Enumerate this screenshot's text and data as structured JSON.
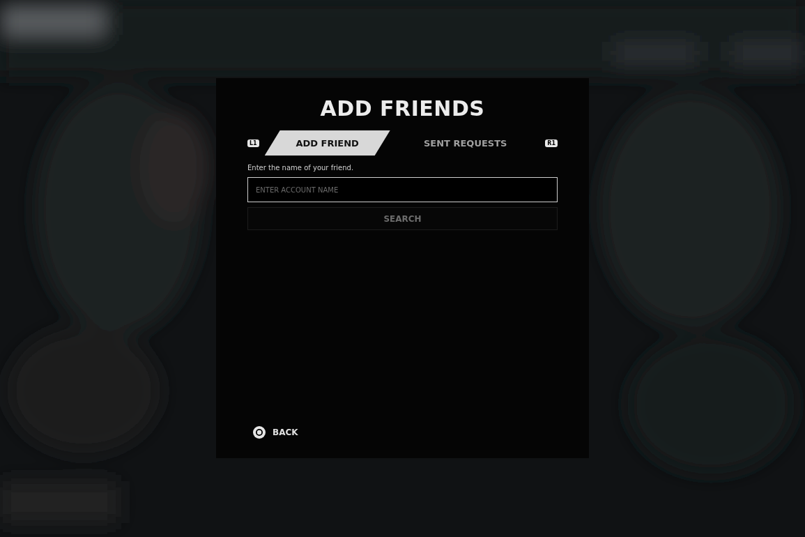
{
  "dialog": {
    "title": "ADD FRIENDS",
    "tab_prev_key": "L1",
    "tab_next_key": "R1",
    "tabs": [
      {
        "label": "ADD FRIEND",
        "selected": true
      },
      {
        "label": "SENT REQUESTS",
        "selected": false
      }
    ],
    "instruction": "Enter the name of your friend.",
    "account_field": {
      "placeholder": "ENTER ACCOUNT NAME"
    },
    "search_button": {
      "label": "SEARCH",
      "disabled": true
    },
    "back_button": {
      "label": "BACK"
    }
  }
}
